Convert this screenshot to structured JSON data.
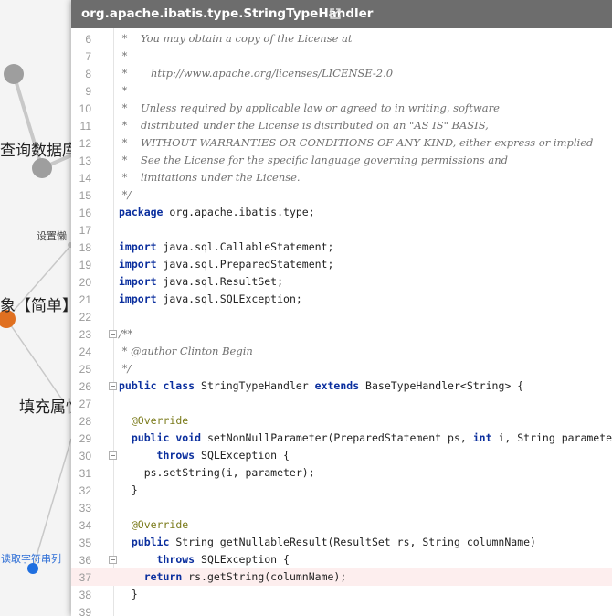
{
  "mindmap": {
    "nodes": [
      {
        "id": "query-db",
        "label": "查询数据库"
      },
      {
        "id": "set-object",
        "label": "设置懒"
      },
      {
        "id": "object-simple",
        "label": "象【简单】"
      },
      {
        "id": "fill-props",
        "label": "填充属性"
      },
      {
        "id": "read-string-column",
        "label": "读取字符串列"
      }
    ],
    "colors": {
      "node_gray": "#9e9e9e",
      "node_orange": "#e07020",
      "node_blue": "#1f6fe0",
      "edge": "#c8c8c8"
    }
  },
  "viewer": {
    "title": "org.apache.ibatis.type.StringTypeHandler",
    "open_icon": "external-link-icon",
    "highlighted_line": 37,
    "lines": [
      {
        "n": "6",
        "fold": false,
        "segs": [
          {
            "t": "cm",
            "s": " *    You may obtain a copy of the License at"
          }
        ]
      },
      {
        "n": "7",
        "fold": false,
        "segs": [
          {
            "t": "cm",
            "s": " *"
          }
        ]
      },
      {
        "n": "8",
        "fold": false,
        "segs": [
          {
            "t": "cm",
            "s": " *       http://www.apache.org/licenses/LICENSE-2.0"
          }
        ]
      },
      {
        "n": "9",
        "fold": false,
        "segs": [
          {
            "t": "cm",
            "s": " *"
          }
        ]
      },
      {
        "n": "10",
        "fold": false,
        "segs": [
          {
            "t": "cm",
            "s": " *    Unless required by applicable law or agreed to in writing, software"
          }
        ]
      },
      {
        "n": "11",
        "fold": false,
        "segs": [
          {
            "t": "cm",
            "s": " *    distributed under the License is distributed on an \"AS IS\" BASIS,"
          }
        ]
      },
      {
        "n": "12",
        "fold": false,
        "segs": [
          {
            "t": "cm",
            "s": " *    WITHOUT WARRANTIES OR CONDITIONS OF ANY KIND, either express or implied"
          }
        ]
      },
      {
        "n": "13",
        "fold": false,
        "segs": [
          {
            "t": "cm",
            "s": " *    See the License for the specific language governing permissions and"
          }
        ]
      },
      {
        "n": "14",
        "fold": false,
        "segs": [
          {
            "t": "cm",
            "s": " *    limitations under the License."
          }
        ]
      },
      {
        "n": "15",
        "fold": false,
        "segs": [
          {
            "t": "cm",
            "s": " */"
          }
        ]
      },
      {
        "n": "16",
        "fold": false,
        "segs": [
          {
            "t": "kw",
            "s": "package"
          },
          {
            "t": "",
            "s": " org.apache.ibatis.type;"
          }
        ]
      },
      {
        "n": "17",
        "fold": false,
        "segs": []
      },
      {
        "n": "18",
        "fold": false,
        "segs": [
          {
            "t": "kw",
            "s": "import"
          },
          {
            "t": "",
            "s": " java.sql.CallableStatement;"
          }
        ]
      },
      {
        "n": "19",
        "fold": false,
        "segs": [
          {
            "t": "kw",
            "s": "import"
          },
          {
            "t": "",
            "s": " java.sql.PreparedStatement;"
          }
        ]
      },
      {
        "n": "20",
        "fold": false,
        "segs": [
          {
            "t": "kw",
            "s": "import"
          },
          {
            "t": "",
            "s": " java.sql.ResultSet;"
          }
        ]
      },
      {
        "n": "21",
        "fold": false,
        "segs": [
          {
            "t": "kw",
            "s": "import"
          },
          {
            "t": "",
            "s": " java.sql.SQLException;"
          }
        ]
      },
      {
        "n": "22",
        "fold": false,
        "segs": []
      },
      {
        "n": "23",
        "fold": true,
        "segs": [
          {
            "t": "cm",
            "s": "/**"
          }
        ]
      },
      {
        "n": "24",
        "fold": false,
        "segs": [
          {
            "t": "cm",
            "s": " * "
          },
          {
            "t": "cmtag",
            "s": "@author"
          },
          {
            "t": "cm",
            "s": " Clinton Begin"
          }
        ]
      },
      {
        "n": "25",
        "fold": false,
        "segs": [
          {
            "t": "cm",
            "s": " */"
          }
        ]
      },
      {
        "n": "26",
        "fold": true,
        "segs": [
          {
            "t": "kw",
            "s": "public class"
          },
          {
            "t": "",
            "s": " StringTypeHandler "
          },
          {
            "t": "kw",
            "s": "extends"
          },
          {
            "t": "",
            "s": " BaseTypeHandler<String> {"
          }
        ]
      },
      {
        "n": "27",
        "fold": false,
        "segs": []
      },
      {
        "n": "28",
        "fold": false,
        "segs": [
          {
            "t": "",
            "s": "  "
          },
          {
            "t": "an",
            "s": "@Override"
          }
        ]
      },
      {
        "n": "29",
        "fold": false,
        "segs": [
          {
            "t": "",
            "s": "  "
          },
          {
            "t": "kw",
            "s": "public void"
          },
          {
            "t": "",
            "s": " setNonNullParameter(PreparedStatement ps, "
          },
          {
            "t": "kw",
            "s": "int"
          },
          {
            "t": "",
            "s": " i, String parameter, JdbcType jdbcType)"
          }
        ]
      },
      {
        "n": "30",
        "fold": true,
        "segs": [
          {
            "t": "",
            "s": "      "
          },
          {
            "t": "kw",
            "s": "throws"
          },
          {
            "t": "",
            "s": " SQLException {"
          }
        ]
      },
      {
        "n": "31",
        "fold": false,
        "segs": [
          {
            "t": "",
            "s": "    ps.setString(i, parameter);"
          }
        ]
      },
      {
        "n": "32",
        "fold": false,
        "segs": [
          {
            "t": "",
            "s": "  }"
          }
        ]
      },
      {
        "n": "33",
        "fold": false,
        "segs": []
      },
      {
        "n": "34",
        "fold": false,
        "segs": [
          {
            "t": "",
            "s": "  "
          },
          {
            "t": "an",
            "s": "@Override"
          }
        ]
      },
      {
        "n": "35",
        "fold": false,
        "segs": [
          {
            "t": "",
            "s": "  "
          },
          {
            "t": "kw",
            "s": "public"
          },
          {
            "t": "",
            "s": " String getNullableResult(ResultSet rs, String columnName)"
          }
        ]
      },
      {
        "n": "36",
        "fold": true,
        "segs": [
          {
            "t": "",
            "s": "      "
          },
          {
            "t": "kw",
            "s": "throws"
          },
          {
            "t": "",
            "s": " SQLException {"
          }
        ]
      },
      {
        "n": "37",
        "fold": false,
        "segs": [
          {
            "t": "",
            "s": "    "
          },
          {
            "t": "kw",
            "s": "return"
          },
          {
            "t": "",
            "s": " rs.getString(columnName);"
          }
        ]
      },
      {
        "n": "38",
        "fold": false,
        "segs": [
          {
            "t": "",
            "s": "  }"
          }
        ]
      },
      {
        "n": "39",
        "fold": false,
        "segs": []
      }
    ]
  }
}
